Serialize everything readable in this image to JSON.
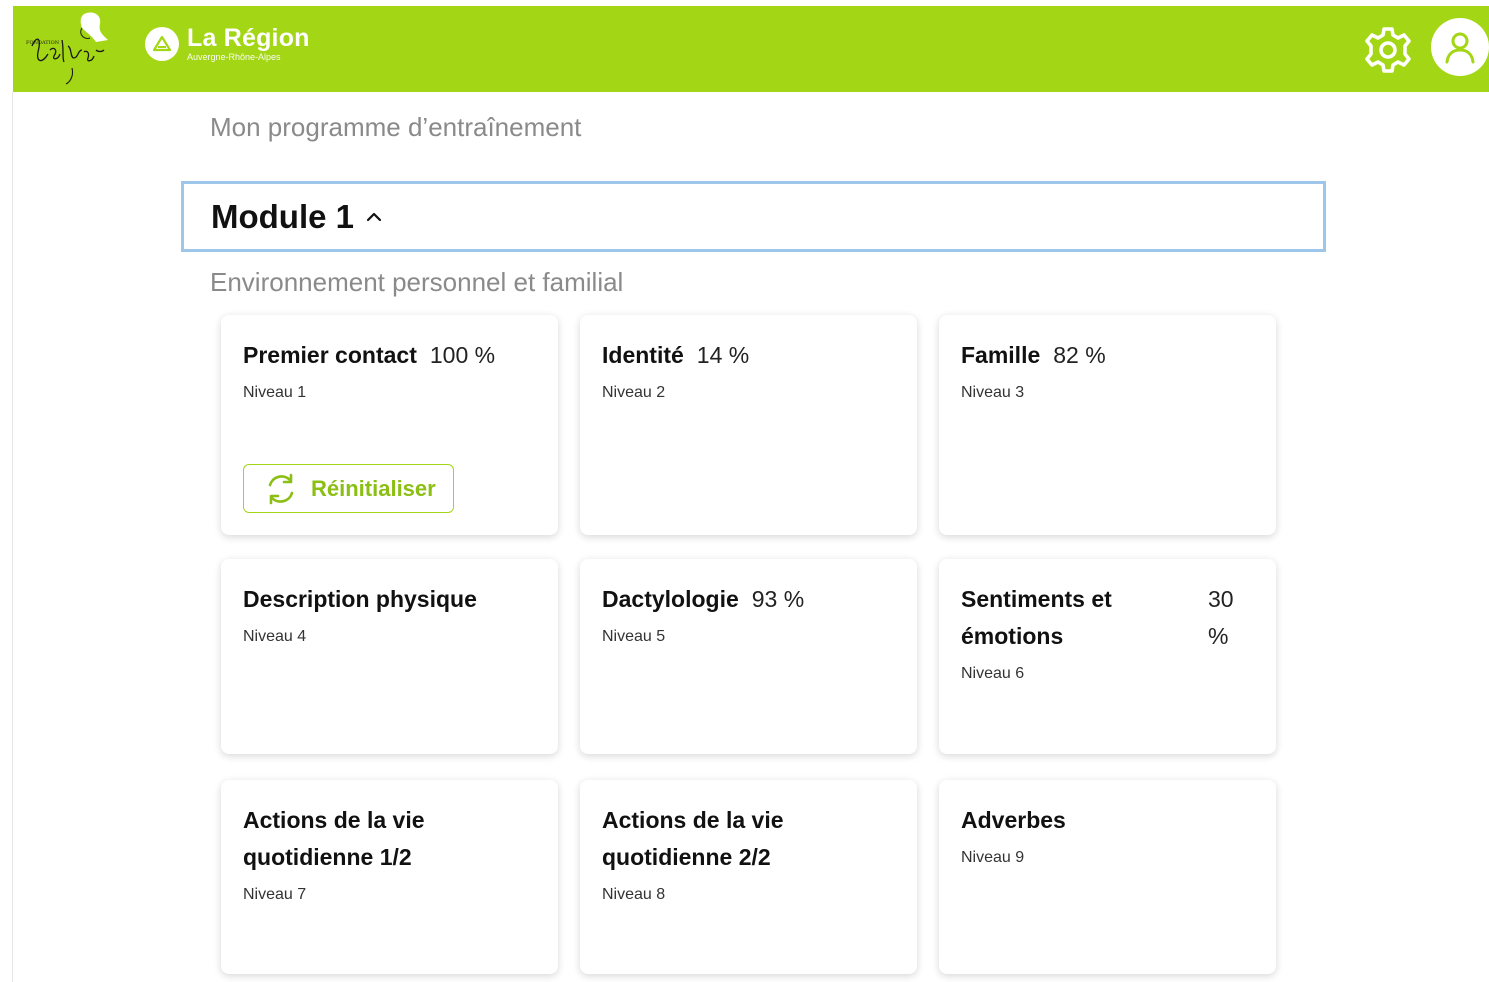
{
  "header": {
    "logo_voltaire_alt": "Fondation Voltaire",
    "region_title": "La Région",
    "region_subtitle": "Auvergne-Rhône-Alpes",
    "accent_color": "#a3d614"
  },
  "page": {
    "title": "Mon programme d’entraînement"
  },
  "module": {
    "title": "Module 1",
    "subtitle": "Environnement personnel et familial"
  },
  "cards": [
    {
      "title": "Premier contact",
      "percent": "100 %",
      "level": "Niveau 1",
      "reset_label": "Réinitialiser"
    },
    {
      "title": "Identité",
      "percent": "14 %",
      "level": "Niveau 2"
    },
    {
      "title": "Famille",
      "percent": "82 %",
      "level": "Niveau 3"
    },
    {
      "title": "Description physique",
      "percent": "",
      "level": "Niveau 4"
    },
    {
      "title": "Dactylologie",
      "percent": "93 %",
      "level": "Niveau 5"
    },
    {
      "title": "Sentiments et émotions",
      "percent": "30 %",
      "level": "Niveau 6"
    },
    {
      "title": "Actions de la vie quotidienne 1/2",
      "percent": "",
      "level": "Niveau 7"
    },
    {
      "title": "Actions de la vie quotidienne 2/2",
      "percent": "",
      "level": "Niveau 8"
    },
    {
      "title": "Adverbes",
      "percent": "",
      "level": "Niveau 9"
    }
  ],
  "icons": {
    "settings": "gear-icon",
    "profile": "user-icon",
    "chevron": "chevron-up-icon",
    "reset": "refresh-icon"
  }
}
